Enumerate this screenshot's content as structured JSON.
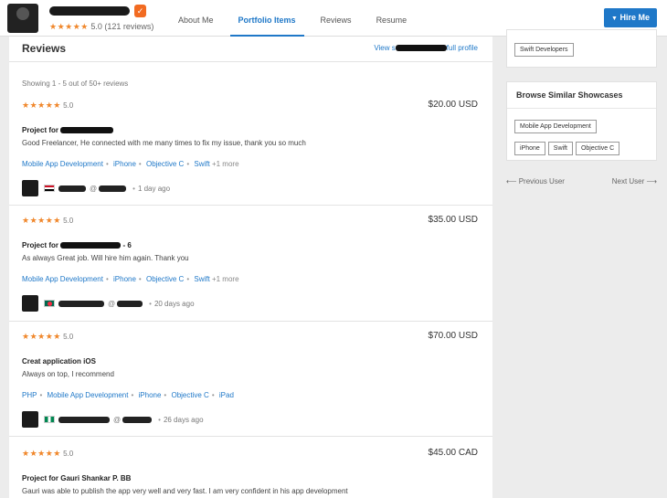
{
  "header": {
    "rating_value": "5.0",
    "reviews_count": "(121 reviews)",
    "stars": "★★★★★",
    "nav_tabs": [
      "About Me",
      "Portfolio Items",
      "Reviews",
      "Resume"
    ],
    "hire_label": "Hire Me",
    "hire_icon": "▼"
  },
  "main": {
    "title": "Reviews",
    "view_link_prefix": "View s",
    "view_link_suffix": "full profile",
    "showing": "Showing 1 - 5 out of 50+ reviews",
    "reviews": [
      {
        "stars": "★★★★★",
        "rating": "5.0",
        "price": "$20.00 USD",
        "title_prefix": "Project for ",
        "title_suffix": "",
        "text": "Good Freelancer, He connected with me many times to fix my issue, thank you so much",
        "tags": [
          "Mobile App Development",
          "iPhone",
          "Objective C",
          "Swift"
        ],
        "more": "+1 more",
        "user_mid": "@",
        "time": "1 day ago"
      },
      {
        "stars": "★★★★★",
        "rating": "5.0",
        "price": "$35.00 USD",
        "title_prefix": "Project for ",
        "title_suffix": " - 6",
        "text": "As always Great job. Will hire him again. Thank you",
        "tags": [
          "Mobile App Development",
          "iPhone",
          "Objective C",
          "Swift"
        ],
        "more": "+1 more",
        "user_mid": "@",
        "time": "20 days ago"
      },
      {
        "stars": "★★★★★",
        "rating": "5.0",
        "price": "$70.00 USD",
        "title_prefix": "Creat application iOS",
        "title_suffix": "",
        "text": "Always on top, I recommend",
        "tags": [
          "PHP",
          "Mobile App Development",
          "iPhone",
          "Objective C",
          "iPad"
        ],
        "more": "",
        "user_mid": "@",
        "time": "26 days ago"
      },
      {
        "stars": "★★★★★",
        "rating": "5.0",
        "price": "$45.00 CAD",
        "title_prefix": "Project for Gauri Shankar P. BB",
        "title_suffix": "",
        "text": "Gauri was able to publish the app very well and very fast. I am very confident in his app development"
      }
    ]
  },
  "sidebar": {
    "top_chip": "Swift Developers",
    "similar_title": "Browse Similar Showcases",
    "similar_chips": [
      "Mobile App Development",
      "iPhone",
      "Swift",
      "Objective C"
    ],
    "prev_label": "⟵  Previous User",
    "next_label": "Next User  ⟶"
  }
}
